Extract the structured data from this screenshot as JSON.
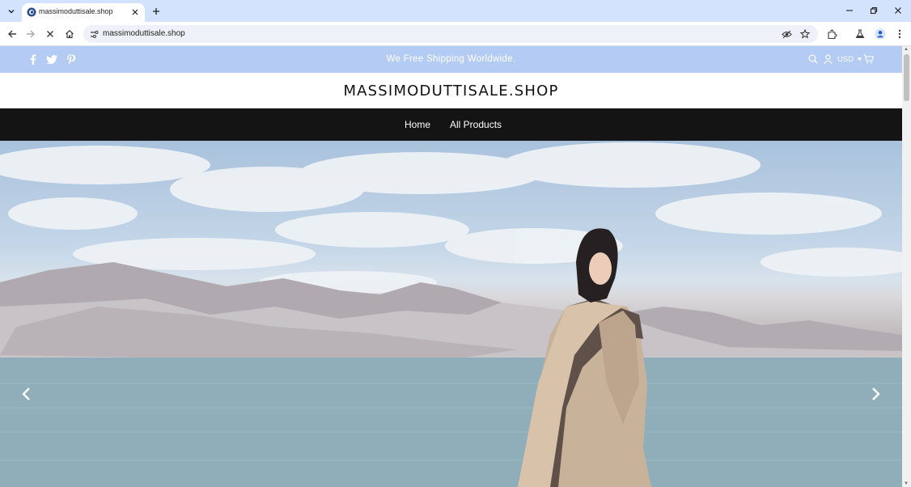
{
  "browser": {
    "tab_title": "massimoduttisale.shop",
    "url": "massimoduttisale.shop"
  },
  "announcement": {
    "text": "We Free Shipping Worldwide.",
    "currency": "USD"
  },
  "site": {
    "logo": "MASSIMODUTTISALE.SHOP"
  },
  "nav": {
    "items": [
      "Home",
      "All Products"
    ]
  },
  "colors": {
    "tabbar": "#d3e3fd",
    "announcement_bar": "#b4cbf4",
    "nav_bar": "#141414"
  },
  "icons": {
    "social": [
      "facebook-icon",
      "twitter-icon",
      "pinterest-icon"
    ],
    "header_utilities": [
      "search-icon",
      "account-icon",
      "cart-icon"
    ],
    "slider": [
      "chevron-left-icon",
      "chevron-right-icon"
    ]
  }
}
